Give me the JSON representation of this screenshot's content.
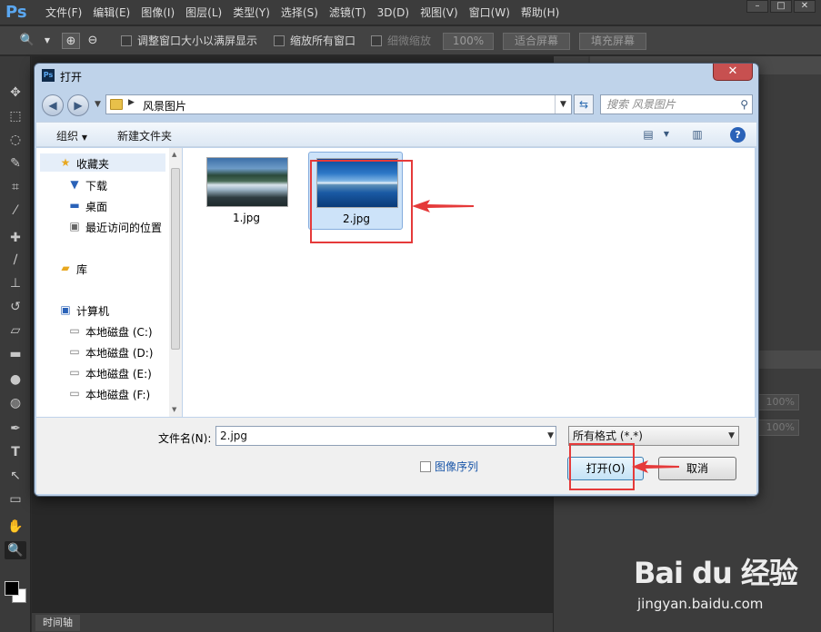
{
  "ps": {
    "logo": "Ps",
    "menu": [
      "文件(F)",
      "编辑(E)",
      "图像(I)",
      "图层(L)",
      "类型(Y)",
      "选择(S)",
      "滤镜(T)",
      "3D(D)",
      "视图(V)",
      "窗口(W)",
      "帮助(H)"
    ],
    "options": {
      "resize_windows": "调整窗口大小以满屏显示",
      "zoom_all": "缩放所有窗口",
      "scrubby_zoom": "细微缩放",
      "zoom_value": "100%",
      "fit_screen": "适合屏幕",
      "fill_screen": "填充屏幕"
    },
    "timeline_tab": "时间轴",
    "panel_values": [
      "100%",
      "100%"
    ]
  },
  "dialog": {
    "icon_text": "Ps",
    "title": "打开",
    "address_path": "风景图片",
    "search_placeholder": "搜索 风景图片",
    "commands": {
      "organize": "组织",
      "new_folder": "新建文件夹"
    },
    "nav": {
      "favorites": "收藏夹",
      "downloads": "下载",
      "desktop": "桌面",
      "recent": "最近访问的位置",
      "libraries": "库",
      "computer": "计算机",
      "drives": [
        "本地磁盘 (C:)",
        "本地磁盘 (D:)",
        "本地磁盘 (E:)",
        "本地磁盘 (F:)"
      ]
    },
    "files": [
      {
        "name": "1.jpg",
        "selected": false
      },
      {
        "name": "2.jpg",
        "selected": true
      }
    ],
    "filename_label": "文件名(N):",
    "filename_value": "2.jpg",
    "filter_value": "所有格式 (*.*)",
    "image_sequence": "图像序列",
    "open_button": "打开(O)",
    "cancel_button": "取消"
  },
  "watermark": {
    "logo": "Bai du 经验",
    "url": "jingyan.baidu.com"
  },
  "colors": {
    "annotation_red": "#e53a3a",
    "selection_blue": "#cde3f9",
    "ps_dark": "#2b2b2b"
  }
}
